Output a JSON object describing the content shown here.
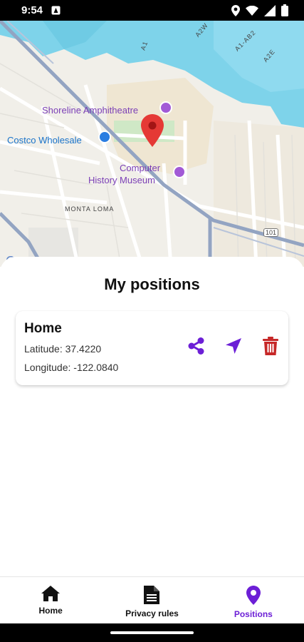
{
  "status_bar": {
    "time": "9:54"
  },
  "map": {
    "labels": {
      "shoreline": "Shoreline Amphitheatre",
      "costco": "Costco Wholesale",
      "museum_line1": "Computer",
      "museum_line2": "History Museum",
      "monta_loma": "MONTA LOMA",
      "road_a1": "A1",
      "road_a2w": "A2W",
      "road_a1ab2": "A1-AB2",
      "road_a2e": "A2E",
      "hwy_101": "101"
    },
    "colors": {
      "water": "#7ed3ea",
      "land": "#f1efe9",
      "marker": "#e53935"
    }
  },
  "sheet": {
    "title": "My positions",
    "positions": [
      {
        "name": "Home",
        "latitude": "Latitude: 37.4220",
        "longitude": "Longitude: -122.0840"
      }
    ]
  },
  "icons": {
    "share": "share-icon",
    "navigate": "navigation-arrow-icon",
    "delete": "trash-icon"
  },
  "colors": {
    "accent": "#6c1fd6",
    "danger": "#c62828"
  },
  "bottom_nav": {
    "items": [
      {
        "label": "Home",
        "icon": "home-icon"
      },
      {
        "label": "Privacy rules",
        "icon": "document-icon"
      },
      {
        "label": "Positions",
        "icon": "location-pin-icon",
        "active": true
      }
    ]
  }
}
